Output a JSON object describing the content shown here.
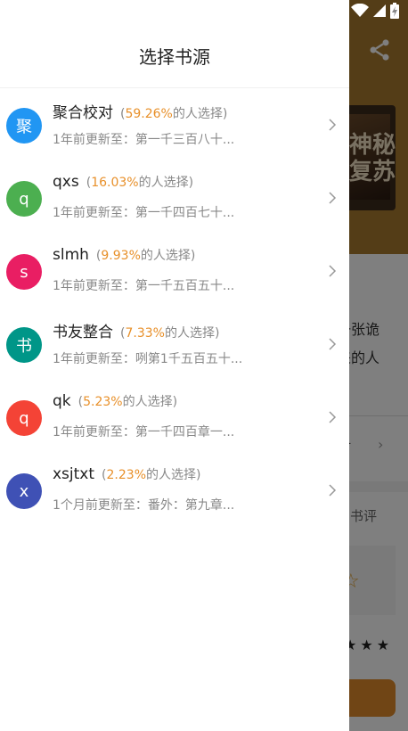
{
  "background": {
    "text_line1": "一张诡",
    "text_line2": "来的人",
    "lamp_label": "灯",
    "review_label": "写书评",
    "cover_text": "神秘复苏"
  },
  "drawer": {
    "title": "选择书源",
    "sources": [
      {
        "avatar": "聚",
        "avatar_color": "#2196F3",
        "name": "聚合校对",
        "percent": "59.26%",
        "percent_suffix": "的人选择)",
        "update": "1年前更新至：第一千三百八十..."
      },
      {
        "avatar": "q",
        "avatar_color": "#4CAF50",
        "name": "qxs",
        "percent": "16.03%",
        "percent_suffix": "的人选择)",
        "update": "1年前更新至：第一千四百七十..."
      },
      {
        "avatar": "s",
        "avatar_color": "#E91E63",
        "name": "slmh",
        "percent": "9.93%",
        "percent_suffix": "的人选择)",
        "update": "1年前更新至：第一千五百五十..."
      },
      {
        "avatar": "书",
        "avatar_color": "#009688",
        "name": "书友整合",
        "percent": "7.33%",
        "percent_suffix": "的人选择)",
        "update": "1年前更新至：咧第1千五百五十..."
      },
      {
        "avatar": "q",
        "avatar_color": "#F44336",
        "name": "qk",
        "percent": "5.23%",
        "percent_suffix": "的人选择)",
        "update": "1年前更新至：第一千四百章一..."
      },
      {
        "avatar": "x",
        "avatar_color": "#3F51B5",
        "name": "xsjtxt",
        "percent": "2.23%",
        "percent_suffix": "的人选择)",
        "update": "1个月前更新至：番外：第九章..."
      }
    ]
  }
}
